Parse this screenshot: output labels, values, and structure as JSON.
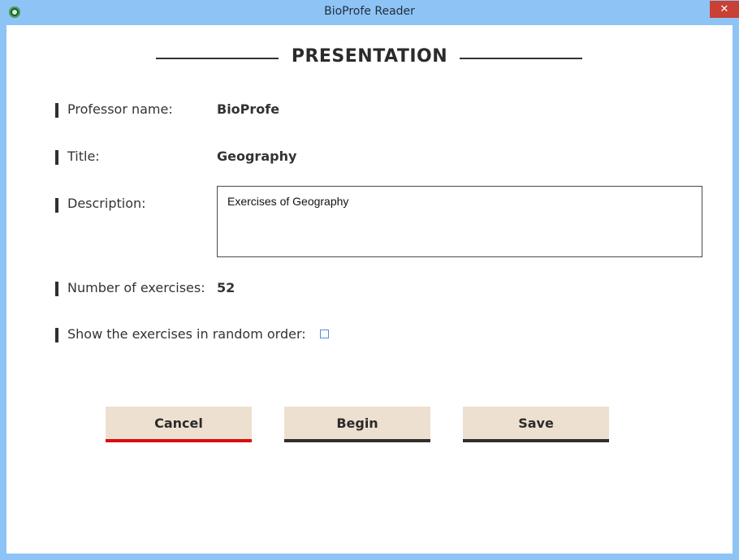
{
  "window": {
    "title": "BioProfe Reader",
    "close_glyph": "✕",
    "icon": "bioprofe-app-icon"
  },
  "presentation": {
    "heading": "PRESENTATION",
    "fields": {
      "professor_label": "Professor name:",
      "professor_value": "BioProfe",
      "title_label": "Title:",
      "title_value": "Geography",
      "description_label": "Description:",
      "description_value": "Exercises of Geography",
      "exercises_label": "Number of exercises:",
      "exercises_value": "52",
      "random_label": "Show the exercises in random order:",
      "random_checked": false
    }
  },
  "buttons": {
    "cancel": "Cancel",
    "begin": "Begin",
    "save": "Save"
  },
  "colors": {
    "titlebar": "#8ec4f5",
    "close": "#c94034",
    "button_bg": "#ede0d0",
    "cancel_accent": "#d90d0d",
    "button_accent": "#2f2f2f"
  }
}
